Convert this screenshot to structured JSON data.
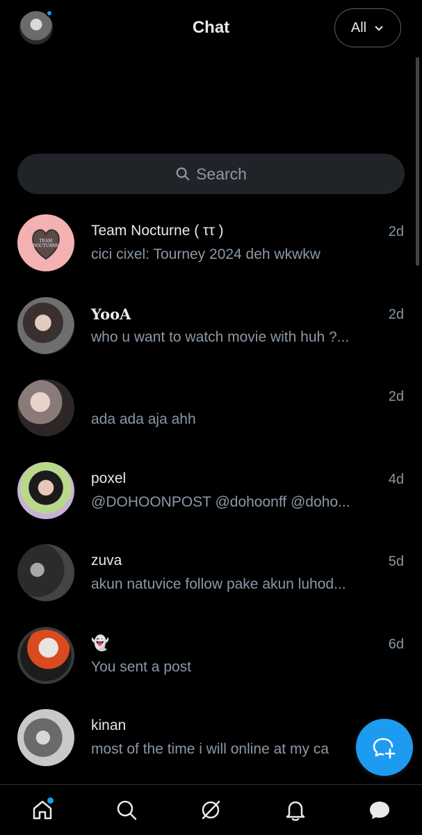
{
  "header": {
    "title": "Chat",
    "filter_label": "All"
  },
  "search": {
    "placeholder": "Search"
  },
  "conversations": [
    {
      "name": "Team Nocturne ( ττ )",
      "message": "cici cixel: Tourney 2024 deh wkwkw",
      "time": "2d",
      "avatar": "pink-heart-logo"
    },
    {
      "name": "YooA",
      "message": "who u want to watch movie with huh ?...",
      "time": "2d",
      "avatar": "photo"
    },
    {
      "name": "",
      "message": "ada ada aja ahh",
      "time": "2d",
      "avatar": "photo"
    },
    {
      "name": "poxel",
      "message": "@DOHOONPOST @dohoonff @doho...",
      "time": "4d",
      "avatar": "photo"
    },
    {
      "name": "zuva",
      "message": "akun natuvice follow pake akun luhod...",
      "time": "5d",
      "avatar": "photo"
    },
    {
      "name": "👻",
      "message": "You sent a post",
      "time": "6d",
      "avatar": "photo"
    },
    {
      "name": "kinan",
      "message": "most of the time i will online at my ca",
      "time": "",
      "avatar": "photo"
    }
  ],
  "colors": {
    "accent": "#1d9bf0",
    "background": "#000000",
    "secondary_text": "#8b98a5",
    "search_bg": "#202327"
  },
  "nav": [
    {
      "icon": "home-icon",
      "has_dot": true
    },
    {
      "icon": "search-icon",
      "has_dot": false
    },
    {
      "icon": "grok-icon",
      "has_dot": false
    },
    {
      "icon": "bell-icon",
      "has_dot": false
    },
    {
      "icon": "chat-icon",
      "has_dot": false
    }
  ]
}
